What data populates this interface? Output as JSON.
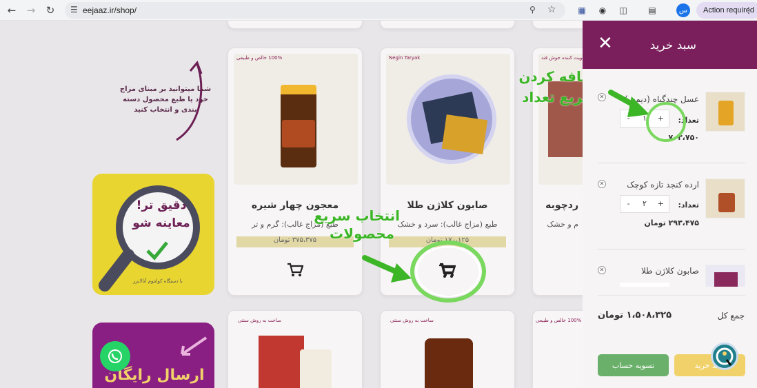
{
  "browser": {
    "url": "eejaaz.ir/shop/",
    "profile_initial": "س",
    "action_required": "Action required"
  },
  "promo": {
    "text_line1": "شما میتوانید بر مبنای مزاج",
    "text_line2": "خود یا طبع محصول دسته",
    "text_line3": "بندی و انتخاب کنید",
    "banner_title_line1": "دقیق تر!",
    "banner_title_line2": "معاینه شو",
    "banner_caption": "با دستگاه کوانتوم آنالایزر",
    "free_shipping": "ارسال رایگان"
  },
  "products": [
    {
      "title": "معجون چهار شیره",
      "sub": "طبع (مزاج غالب): گرم و تر",
      "price": "۳۷۵،۳۷۵ تومان",
      "tag": "100% خالص و طبیعی"
    },
    {
      "title": "صابون کلاژن طلا",
      "sub": "طبع (مزاج غالب): سرد و خشک",
      "price": "۱۷۰،۱۲۵ تومان",
      "tag": "Negin Taryak"
    },
    {
      "title": "ردچوبه",
      "sub": "م و خشک",
      "price": "",
      "tag": "تقویت کننده جوش قند"
    }
  ],
  "products_row2": [
    {
      "tag": "ساخت به روش سنتی"
    },
    {
      "tag": "ساخت به روش سنتی"
    },
    {
      "tag": "100% خالص و طبیعی"
    }
  ],
  "annotations": {
    "quick_select_line1": "انتخاب سریع",
    "quick_select_line2": "محصولات",
    "quick_add_line1": "اضافه کردن",
    "quick_add_line2": "سریع تعداد"
  },
  "cart": {
    "title": "سبد خرید",
    "qty_label": "تعداد:",
    "items": [
      {
        "name": "عسل چندگیاه (دیمت)",
        "qty": "۱",
        "price": "۷۰۳،۷۵۰"
      },
      {
        "name": "ارده کنجد تازه کوچک",
        "qty": "۲",
        "price": "۲۹۳،۴۷۵ تومان"
      },
      {
        "name": "صابون کلاژن طلا",
        "qty": "",
        "price": ""
      }
    ],
    "total_label": "جمع کل",
    "total_value": "۱،۵۰۸،۳۲۵ تومان",
    "checkout_label": "تسویه حساب",
    "view_cart_label": "سبد خرید"
  },
  "colors": {
    "brand": "#7a1f5c",
    "checkout": "#6ab06a",
    "view_cart": "#f1d26a",
    "annotation": "#3cb626"
  }
}
